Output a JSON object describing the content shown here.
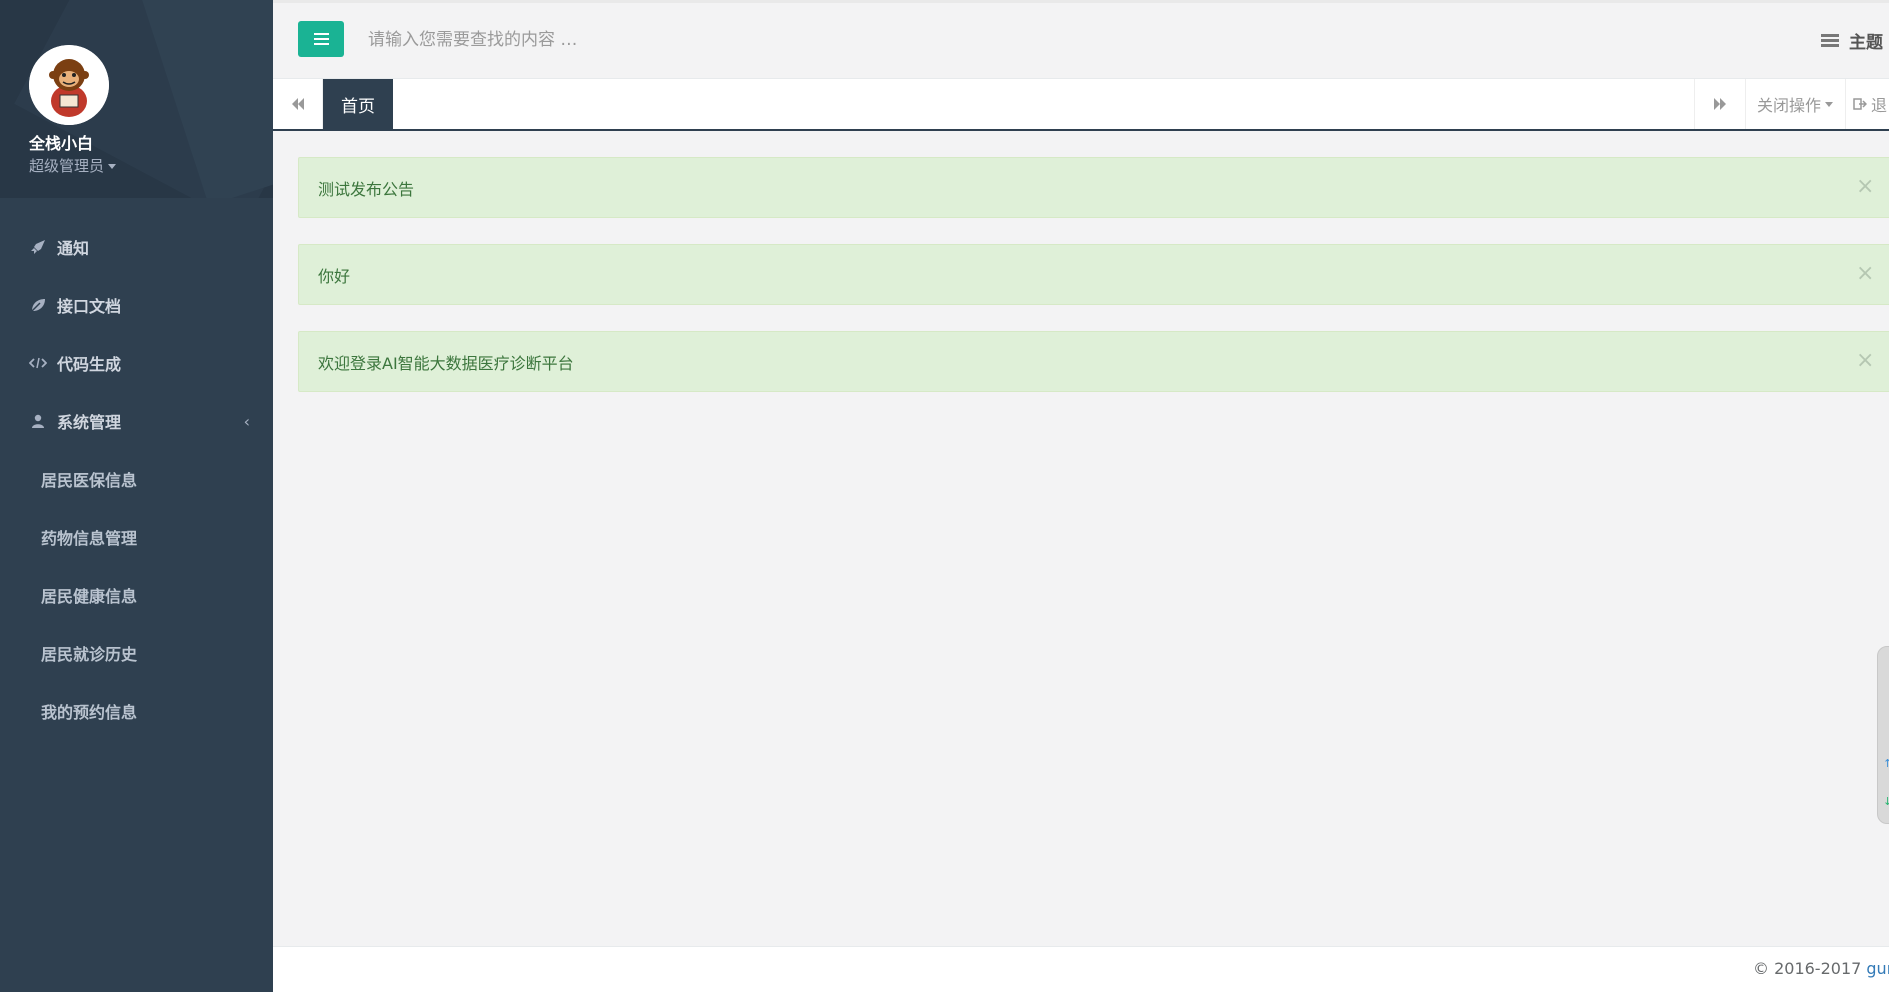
{
  "sidebar": {
    "profile": {
      "name": "全栈小白",
      "role": "超级管理员",
      "avatar_icon": "monkey-avatar-icon"
    },
    "items": [
      {
        "label": "通知",
        "icon": "rocket-icon"
      },
      {
        "label": "接口文档",
        "icon": "leaf-icon"
      },
      {
        "label": "代码生成",
        "icon": "code-icon"
      },
      {
        "label": "系统管理",
        "icon": "user-icon",
        "expandable": true
      }
    ],
    "subitems": [
      {
        "label": "居民医保信息"
      },
      {
        "label": "药物信息管理"
      },
      {
        "label": "居民健康信息"
      },
      {
        "label": "居民就诊历史"
      },
      {
        "label": "我的预约信息"
      }
    ]
  },
  "header": {
    "search_placeholder": "请输入您需要查找的内容 …",
    "theme_label": "主题"
  },
  "tabs": {
    "home_label": "首页",
    "close_ops_label": "关闭操作",
    "logout_label": "退"
  },
  "alerts": [
    {
      "text": "测试发布公告"
    },
    {
      "text": "你好"
    },
    {
      "text": "欢迎登录AI智能大数据医疗诊断平台"
    }
  ],
  "footer": {
    "copyright": "© 2016-2017",
    "link_text": "guns"
  },
  "colors": {
    "sidebar": "#2f4050",
    "accent": "#1ab394",
    "alert_bg": "#dff0d8",
    "alert_text": "#3c763d"
  }
}
